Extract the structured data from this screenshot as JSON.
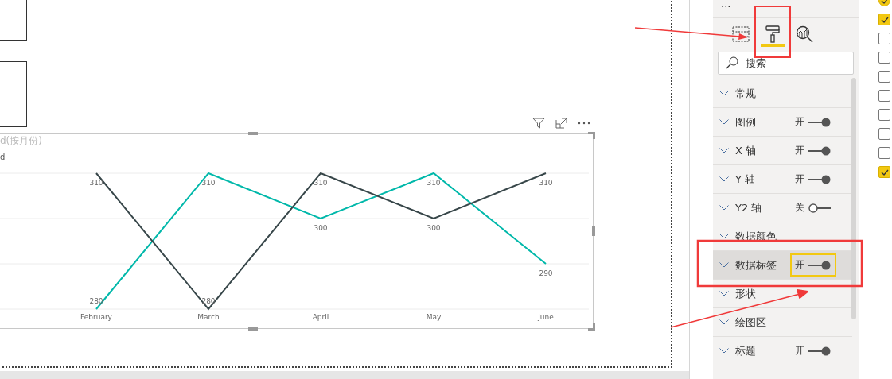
{
  "chart": {
    "title": "d(按月份)",
    "legend": "d",
    "chart_data": {
      "type": "line",
      "categories": [
        "February",
        "March",
        "April",
        "May",
        "June"
      ],
      "series": [
        {
          "color": "#01b8aa",
          "values": [
            280,
            310,
            300,
            310,
            290
          ]
        },
        {
          "color": "#374649",
          "values": [
            310,
            280,
            310,
            300,
            310
          ]
        }
      ],
      "ref_lines": [
        {
          "axis": "y",
          "value": 280
        },
        {
          "axis": "y",
          "value": 290
        },
        {
          "axis": "y",
          "value": 300
        },
        {
          "axis": "y",
          "value": 310
        }
      ],
      "data_labels": true
    }
  },
  "format_pane": {
    "more": "···",
    "tabs": [
      {
        "kind": "fields",
        "selected": false
      },
      {
        "kind": "format",
        "selected": true
      },
      {
        "kind": "analytics",
        "selected": false
      }
    ],
    "search": {
      "placeholder": "搜索"
    },
    "sections": [
      {
        "label": "常规",
        "kind": "plain",
        "selected": false
      },
      {
        "label": "图例",
        "kind": "toggle",
        "toggle_label": "开",
        "on": true,
        "focused": false,
        "selected": false
      },
      {
        "label": "X 轴",
        "kind": "toggle",
        "toggle_label": "开",
        "on": true,
        "focused": false,
        "selected": false
      },
      {
        "label": "Y 轴",
        "kind": "toggle",
        "toggle_label": "开",
        "on": true,
        "focused": false,
        "selected": false
      },
      {
        "label": "Y2 轴",
        "kind": "toggle",
        "toggle_label": "关",
        "on": false,
        "focused": false,
        "selected": false
      },
      {
        "label": "数据颜色",
        "kind": "plain",
        "selected": false
      },
      {
        "label": "数据标签",
        "kind": "toggle",
        "toggle_label": "开",
        "on": true,
        "focused": true,
        "selected": true
      },
      {
        "label": "形状",
        "kind": "plain",
        "selected": false
      },
      {
        "label": "绘图区",
        "kind": "plain",
        "selected": false
      },
      {
        "label": "标题",
        "kind": "toggle",
        "toggle_label": "开",
        "on": true,
        "focused": false,
        "selected": false
      }
    ]
  },
  "field_checks": [
    {
      "checked": true
    },
    {
      "checked": true
    },
    {
      "checked": false
    },
    {
      "checked": false
    },
    {
      "checked": false
    },
    {
      "checked": false
    },
    {
      "checked": false
    },
    {
      "checked": false
    },
    {
      "checked": false
    },
    {
      "checked": true
    }
  ]
}
